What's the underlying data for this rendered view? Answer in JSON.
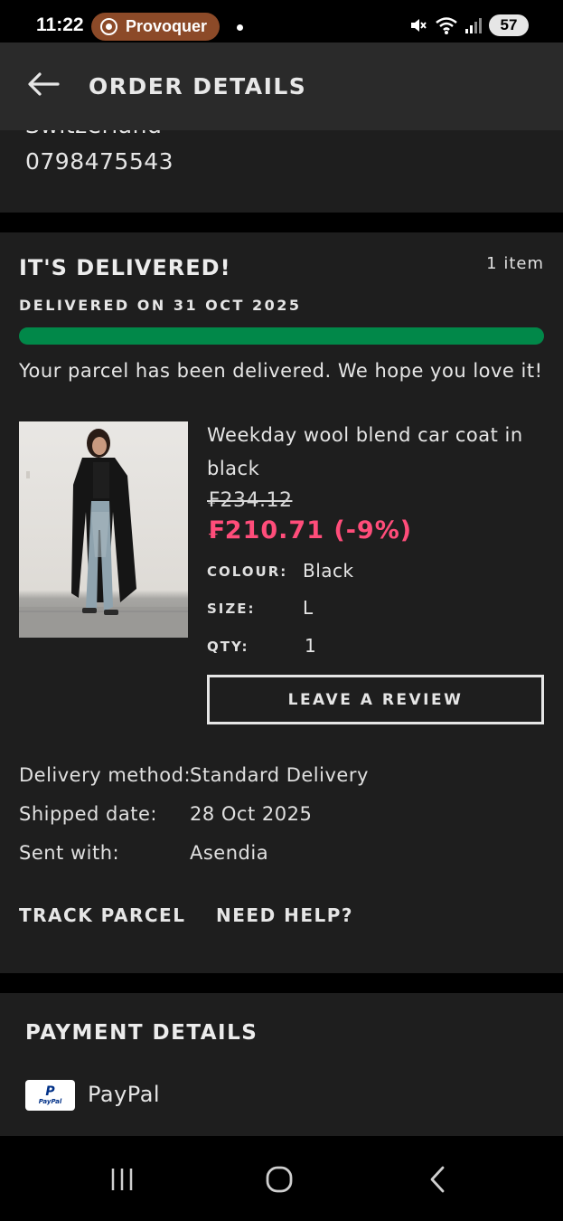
{
  "status_bar": {
    "time": "11:22",
    "recording_app": "Provoquer",
    "battery": "57",
    "icons": [
      "record-icon",
      "mute-icon",
      "wifi-icon",
      "signal-icon",
      "battery-icon"
    ]
  },
  "header": {
    "title": "ORDER DETAILS",
    "back_icon": "back-arrow-icon"
  },
  "address": {
    "country_partial": "Switzerland",
    "phone": "0798475543"
  },
  "delivery": {
    "status_title": "IT'S DELIVERED!",
    "item_count": "1 item",
    "delivered_on": "DELIVERED ON 31 OCT 2025",
    "progress": 1.0,
    "message": "Your parcel has been delivered. We hope you love it!",
    "product": {
      "name": "Weekday wool blend car coat in black",
      "original_price": "₣234.12",
      "sale_price": "₣210.71 (-9%)",
      "colour_label": "COLOUR:",
      "colour_value": "Black",
      "size_label": "SIZE:",
      "size_value": "L",
      "qty_label": "QTY:",
      "qty_value": "1"
    },
    "review_button": "LEAVE A REVIEW",
    "details": [
      {
        "label": "Delivery method:",
        "value": "Standard Delivery"
      },
      {
        "label": "Shipped date:",
        "value": "28 Oct 2025"
      },
      {
        "label": "Sent with:",
        "value": "Asendia"
      }
    ],
    "track_parcel": "TRACK PARCEL",
    "need_help": "NEED HELP?"
  },
  "payment": {
    "title": "PAYMENT DETAILS",
    "method": "PayPal",
    "logo_text": "PayPal"
  },
  "colors": {
    "accent_green": "#018849",
    "sale_pink": "#ff4d7a",
    "card_bg": "#1e1e1e",
    "header_bg": "#2a2a2a"
  }
}
